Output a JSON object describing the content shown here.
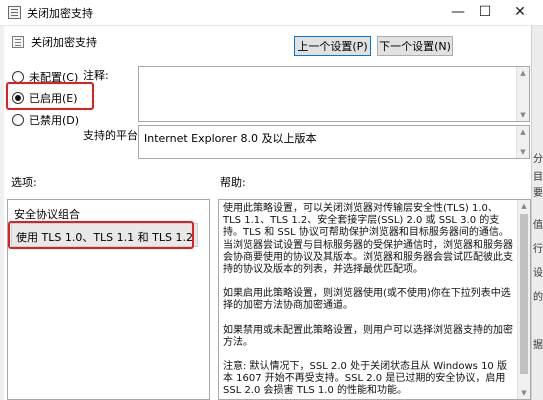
{
  "window": {
    "title": "关闭加密支持",
    "controls": {
      "minimize": "—",
      "maximize": "☐",
      "close": "✕"
    }
  },
  "header": {
    "policy_name": "关闭加密支持",
    "prev_button": "上一个设置(P)",
    "next_button": "下一个设置(N)"
  },
  "state": {
    "options": [
      {
        "label": "未配置(C)",
        "checked": false
      },
      {
        "label": "已启用(E)",
        "checked": true
      },
      {
        "label": "已禁用(D)",
        "checked": false
      }
    ],
    "highlight_color": "#e02020"
  },
  "comment": {
    "label": "注释:",
    "value": ""
  },
  "supported": {
    "label": "支持的平台:",
    "value": "Internet Explorer 8.0 及以上版本"
  },
  "options_section": {
    "label": "选项:",
    "group_title": "安全协议组合",
    "selected_value": "使用 TLS 1.0、TLS 1.1 和 TLS 1.2"
  },
  "help_section": {
    "label": "帮助:",
    "paragraphs": [
      "使用此策略设置，可以关闭浏览器对传输层安全性(TLS) 1.0、TLS 1.1、TLS 1.2、安全套接字层(SSL) 2.0 或 SSL 3.0 的支持。TLS 和 SSL 协议可帮助保护浏览器和目标服务器间的通信。当浏览器尝试设置与目标服务器的受保护通信时，浏览器和服务器会协商要使用的协议及其版本。浏览器和服务器会尝试匹配彼此支持的协议及版本的列表，并选择最优匹配项。",
      "如果启用此策略设置，则浏览器使用(或不使用)你在下拉列表中选择的加密方法协商加密通道。",
      "如果禁用或未配置此策略设置，则用户可以选择浏览器支持的加密方法。",
      "注意: 默认情况下，SSL 2.0 处于关闭状态且从 Windows 10 版本 1607 开始不再受支持。SSL 2.0 是已过期的安全协议，启用 SSL 2.0 会损害 TLS 1.0 的性能和功能。"
    ]
  },
  "side_strip": {
    "chars": [
      "分",
      "目",
      "要",
      "值",
      "行",
      "设",
      "的",
      "据"
    ]
  }
}
